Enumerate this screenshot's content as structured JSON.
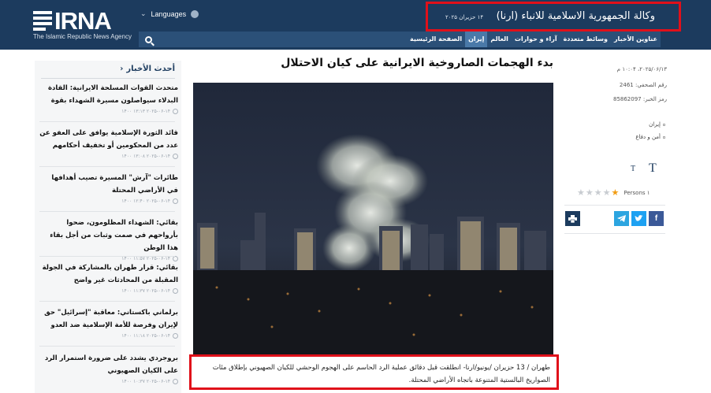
{
  "header": {
    "logo_word": "IRNA",
    "logo_sub": "The Islamic Republic News Agency",
    "language_label": "Languages",
    "site_title": "وكالة الجمهورية الاسلامية للانباء (ارنا)",
    "site_date": "۱۴ حزیران ۲۰۲۵",
    "nav": [
      "الصفحة الرئيسية",
      "إيران",
      "العالم",
      "آراء و حوارات",
      "وسائط متعددة",
      "عناوين الأخبار"
    ],
    "active_nav_index": 1
  },
  "sidebar": {
    "heading": "أحدث الأخبار",
    "items": [
      {
        "title": "متحدث القوات المسلحة الايرانية: القادة البدلاء سيواصلون مسيرة الشهداء بقوة",
        "time": "۱۴۰۰ ۱۳:۱۳ ۲۰۲۵-۰۶-۱۴"
      },
      {
        "title": "قائد الثورة الإسلامية يوافق على العفو عن عدد من المحكومين أو تخفيف أحكامهم",
        "time": "۱۴۰۰ ۱۳:۰۸ ۲۰۲۵-۰۶-۱۴"
      },
      {
        "title": "طائرات \"آرش\" المسيرة تصيب أهدافها في الأراضي المحتلة",
        "time": "۱۴۰۰ ۱۲:۴۰ ۲۰۲۵-۰۶-۱۴"
      },
      {
        "title": "بقائي: الشهداء المظلومون، ضحوا بأرواحهم في صمت وثبات من أجل بقاء هذا الوطن",
        "time": "۱۴۰۰ ۱۱:۵۷ ۲۰۲۵-۰۶-۱۴"
      },
      {
        "title": "بقائي: قرار طهران بالمشاركة في الجولة المقبلة من المحادثات غير واضح",
        "time": "۱۴۰۰ ۱۱:۳۷ ۲۰۲۵-۰۶-۱۴"
      },
      {
        "title": "برلماني باكستاني: معاقبة \"إسرائيل\" حق لإيران وفرصة للأمة الإسلامية ضد العدو",
        "time": "۱۴۰۰ ۱۱:۱۸ ۲۰۲۵-۰۶-۱۴"
      },
      {
        "title": "بروجردي يشدد على ضرورة استمرار الرد على الكيان الصهيوني",
        "time": "۱۴۰۰ ۱۰:۳۷ ۲۰۲۵-۰۶-۱۴"
      }
    ]
  },
  "article": {
    "title": "بدء الهجمات الصاروخية الايرانية على كيان الاحتلال",
    "lead": "طهران / 13 حزيران /يونيو/ارنا- انطلقت قبل دقائق عملية الرد الحاسم على الهجوم الوحشي للكيان الصهيوني بإطلاق مئات الصواريخ البالستية المتنوعة باتجاه الأراضي المحتلة.",
    "photo_icon": "night-city-explosion-photo"
  },
  "meta": {
    "datetime": "۲۰۲۵/۰۶/۱۳، ۱۰:۰۴ م",
    "news_number_label": "رقم الصحفي: 2461",
    "news_code_label": "رمز الخبر: 85862097",
    "tags": [
      "إيران",
      "أمن و دفاع"
    ],
    "font_large": "T",
    "font_small": "T",
    "rating": {
      "stars_on": 1,
      "stars_total": 5,
      "persons": "Persons ۱"
    },
    "share": [
      "facebook-icon",
      "twitter-icon",
      "telegram-icon"
    ],
    "print_icon": "print-icon"
  },
  "colors": {
    "header_bg": "#1c3b5e",
    "nav_bg": "#2b5078",
    "nav_active": "#4a79a8",
    "highlight_red": "#e0101a",
    "facebook": "#3b5998",
    "twitter": "#1da1f2",
    "telegram": "#2ca5e0",
    "print": "#1c3b5e"
  }
}
